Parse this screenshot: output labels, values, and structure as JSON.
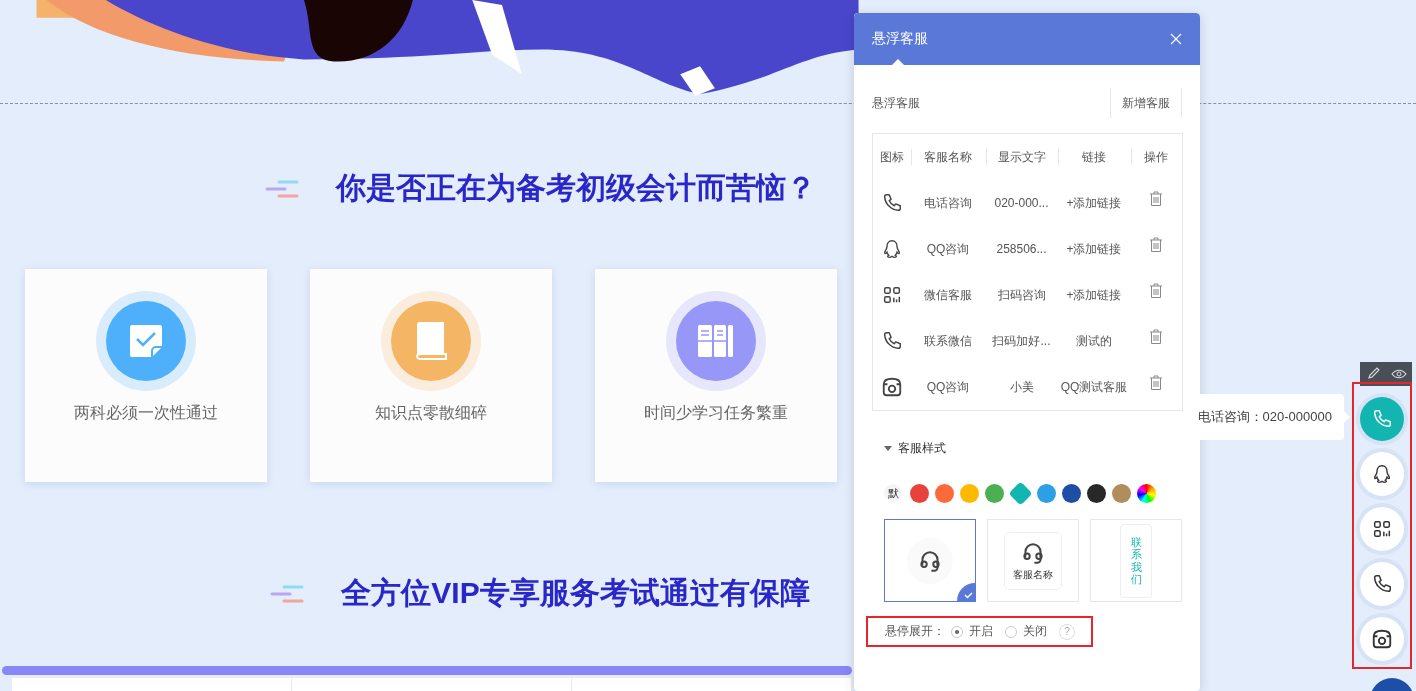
{
  "page": {
    "headings": [
      "你是否正在为备考初级会计而苦恼？",
      "全方位VIP专享服务考试通过有保障"
    ],
    "cards": [
      {
        "label": "两科必须一次性通过",
        "kind": "check-note",
        "color": "#4eb0fb"
      },
      {
        "label": "知识点零散细碎",
        "kind": "book",
        "color": "#f4b564"
      },
      {
        "label": "时间少学习任务繁重",
        "kind": "books",
        "color": "#9697f7"
      }
    ]
  },
  "panel": {
    "title": "悬浮客服",
    "section_label": "悬浮客服",
    "add_button": "新增客服",
    "table": {
      "columns": [
        "图标",
        "客服名称",
        "显示文字",
        "链接",
        "操作"
      ],
      "rows": [
        {
          "kind": "phone",
          "name": "电话咨询",
          "text": "020-000...",
          "link": "+添加链接"
        },
        {
          "kind": "penguin",
          "name": "QQ咨询",
          "text": "258506...",
          "link": "+添加链接"
        },
        {
          "kind": "grid",
          "name": "微信客服",
          "text": "扫码咨询",
          "link": "+添加链接"
        },
        {
          "kind": "phone",
          "name": "联系微信",
          "text": "扫码加好...",
          "link": "测试的"
        },
        {
          "kind": "rotary",
          "name": "QQ咨询",
          "text": "小美",
          "link": "QQ测试客服"
        }
      ]
    },
    "style": {
      "label": "客服样式",
      "expanded": true,
      "default_label": "默",
      "colors": [
        {
          "kind": "solid",
          "color": "#e8433a",
          "selected": false
        },
        {
          "kind": "solid",
          "color": "#fd6a37",
          "selected": false
        },
        {
          "kind": "solid",
          "color": "#fdb900",
          "selected": false
        },
        {
          "kind": "solid",
          "color": "#4cb050",
          "selected": false
        },
        {
          "kind": "solid",
          "color": "#13b5b1",
          "selected": true
        },
        {
          "kind": "solid",
          "color": "#2d9fe6",
          "selected": false
        },
        {
          "kind": "solid",
          "color": "#1e4fa8",
          "selected": false
        },
        {
          "kind": "solid",
          "color": "#282828",
          "selected": false
        },
        {
          "kind": "solid",
          "color": "#b08d5a",
          "selected": false
        },
        {
          "kind": "gradient",
          "selected": false
        }
      ],
      "layouts": [
        {
          "kind": "circle",
          "selected": true
        },
        {
          "kind": "card",
          "label": "客服名称",
          "selected": false
        },
        {
          "kind": "vertical",
          "label": "联系我们",
          "selected": false
        }
      ]
    },
    "hover_expand": {
      "label": "悬停展开：",
      "options": [
        {
          "label": "开启",
          "selected": true
        },
        {
          "label": "关闭",
          "selected": false
        }
      ],
      "help": "?"
    }
  },
  "sidebar": {
    "tooltip": "电话咨询：020-000000",
    "buttons": [
      {
        "kind": "phone",
        "selected": true
      },
      {
        "kind": "penguin",
        "selected": false
      },
      {
        "kind": "grid",
        "selected": false
      },
      {
        "kind": "phone",
        "selected": false
      },
      {
        "kind": "rotary",
        "selected": false
      }
    ]
  }
}
